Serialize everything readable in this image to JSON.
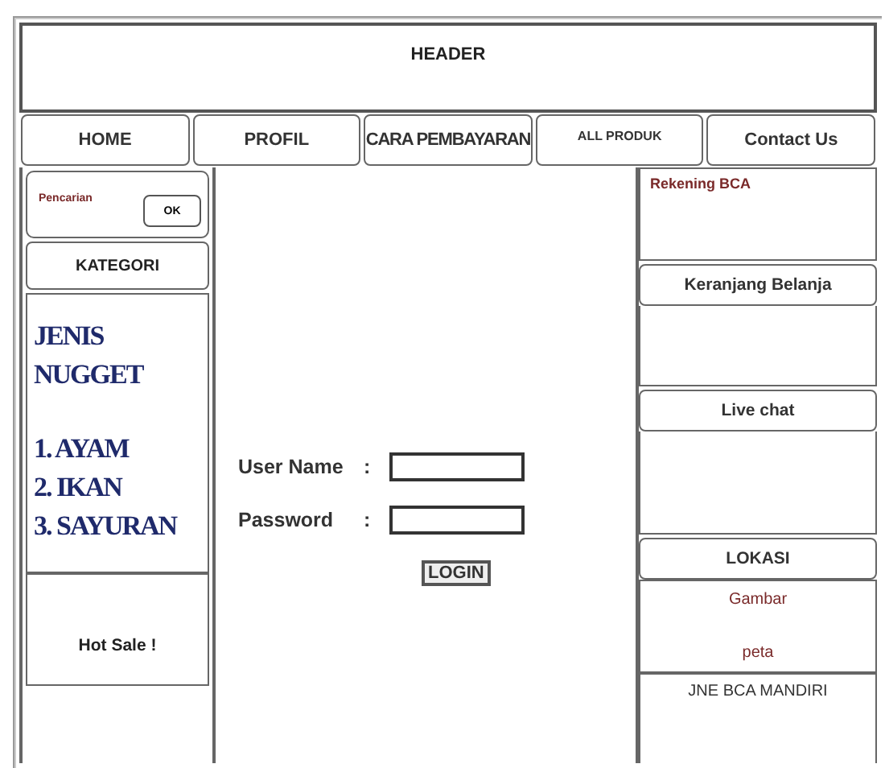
{
  "header": {
    "title": "HEADER"
  },
  "nav": [
    {
      "label": "HOME"
    },
    {
      "label": "PROFIL"
    },
    {
      "label": "CARA PEMBAYARAN"
    },
    {
      "label": "ALL PRODUK",
      "kind": "small"
    },
    {
      "label": "Contact Us"
    }
  ],
  "sidebar_left": {
    "search": {
      "label": "Pencarian",
      "button": "OK"
    },
    "category_heading": "KATEGORI",
    "category_box": {
      "title": "JENIS NUGGET",
      "items": [
        "1. AYAM",
        "2. IKAN",
        "3. SAYURAN"
      ]
    },
    "promo": "Hot Sale !"
  },
  "login": {
    "fields": [
      {
        "label": "User Name",
        "separator": ":"
      },
      {
        "label": "Password",
        "separator": ":"
      }
    ],
    "button": "LOGIN"
  },
  "sidebar_right": {
    "bank": "Rekening  BCA",
    "cart": "Keranjang Belanja",
    "chat": "Live chat",
    "location": "LOKASI",
    "map": [
      "Gambar",
      "peta"
    ],
    "shipping": "JNE  BCA MANDIRI"
  }
}
